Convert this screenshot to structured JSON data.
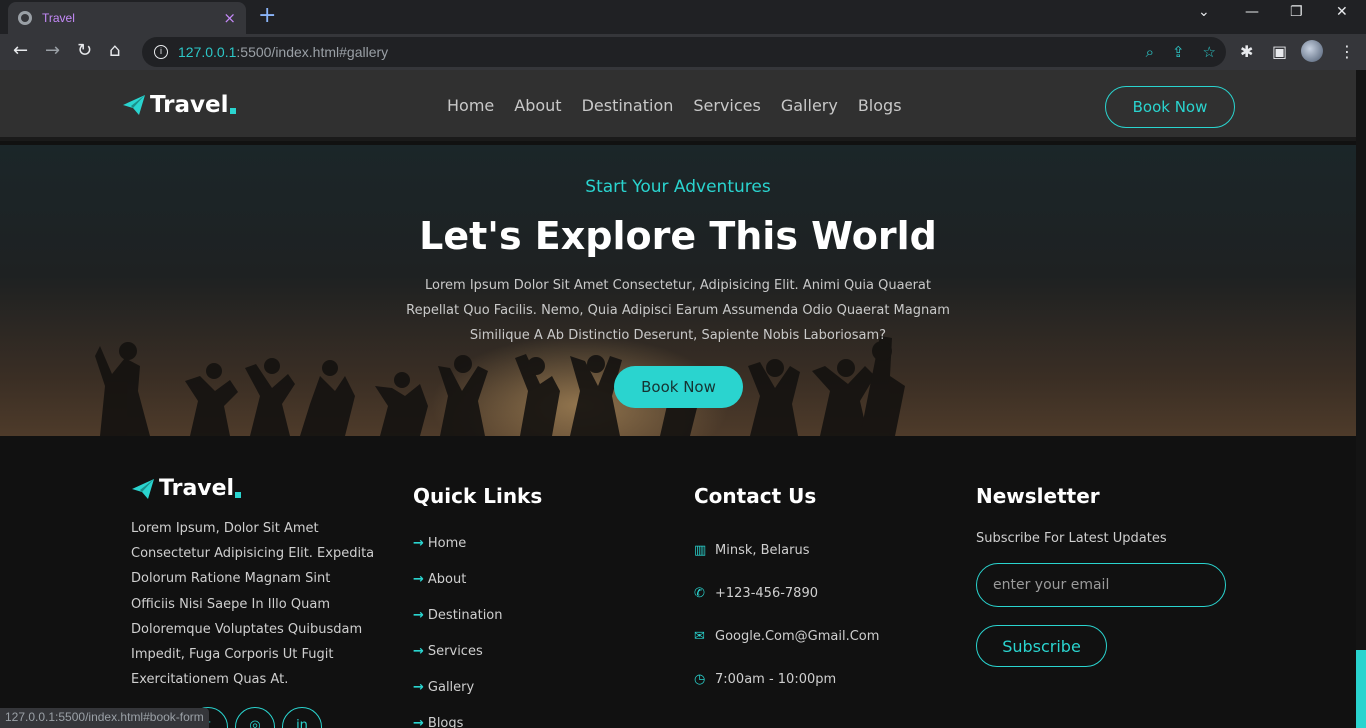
{
  "browser": {
    "tab_title": "Travel",
    "tab_close": "×",
    "new_tab": "+",
    "url_host": "127.0.0.1",
    "url_path": ":5500/index.html#gallery",
    "status_url": "127.0.0.1:5500/index.html#book-form",
    "accent": "#2ad4cf"
  },
  "nav": {
    "logo": "Travel",
    "links": [
      "Home",
      "About",
      "Destination",
      "Services",
      "Gallery",
      "Blogs"
    ],
    "cta": "Book Now"
  },
  "hero": {
    "subtitle": "Start Your Adventures",
    "title": "Let's Explore This World",
    "description": "Lorem Ipsum Dolor Sit Amet Consectetur, Adipisicing Elit. Animi Quia Quaerat Repellat Quo Facilis. Nemo, Quia Adipisci Earum Assumenda Odio Quaerat Magnam Similique A Ab Distinctio Deserunt, Sapiente Nobis Laboriosam?",
    "button": "Book Now"
  },
  "footer": {
    "logo": "Travel",
    "about": "Lorem Ipsum, Dolor Sit Amet Consectetur Adipisicing Elit. Expedita Dolorum Ratione Magnam Sint Officiis Nisi Saepe In Illo Quam Doloremque Voluptates Quibusdam Impedit, Fuga Corporis Ut Fugit Exercitationem Quas At.",
    "quick_links_title": "Quick Links",
    "quick_links": [
      "Home",
      "About",
      "Destination",
      "Services",
      "Gallery",
      "Blogs"
    ],
    "contact_title": "Contact Us",
    "contact": {
      "location": "Minsk, Belarus",
      "phone": "+123-456-7890",
      "email": "Google.Com@Gmail.Com",
      "hours": "7:00am - 10:00pm"
    },
    "newsletter_title": "Newsletter",
    "newsletter_sub": "Subscribe For Latest Updates",
    "newsletter_placeholder": "enter your email",
    "subscribe": "Subscribe"
  }
}
